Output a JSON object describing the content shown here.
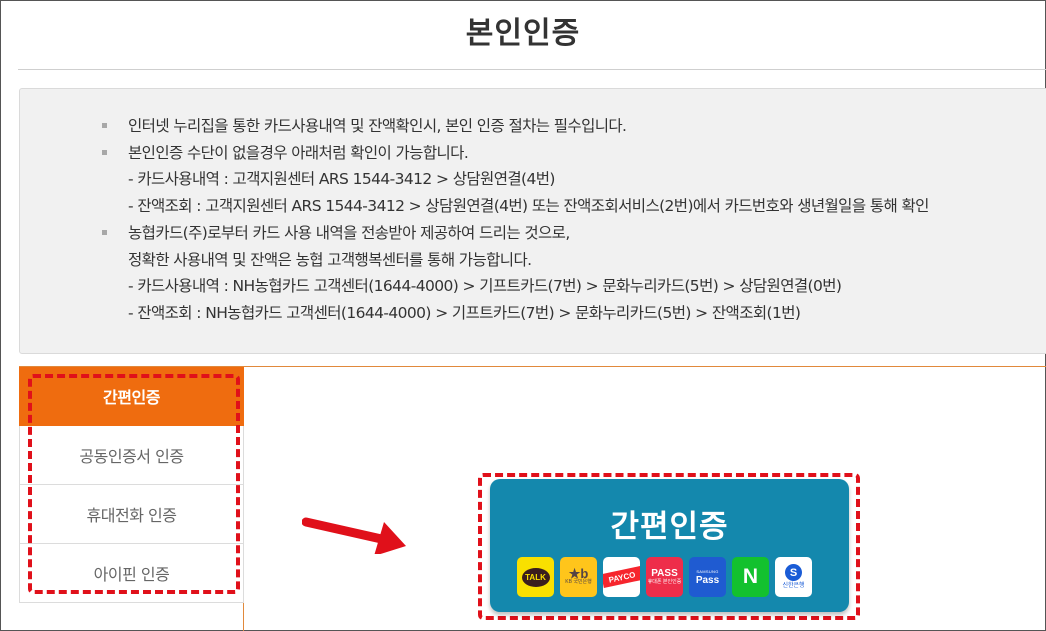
{
  "page": {
    "title": "본인인증"
  },
  "notice": {
    "items": [
      {
        "lines": [
          "인터넷 누리집을 통한 카드사용내역 및 잔액확인시, 본인 인증 절차는 필수입니다."
        ]
      },
      {
        "lines": [
          "본인인증 수단이 없을경우 아래처럼 확인이 가능합니다.",
          "- 카드사용내역 : 고객지원센터 ARS 1544-3412 > 상담원연결(4번)",
          "- 잔액조회 : 고객지원센터 ARS 1544-3412 > 상담원연결(4번) 또는 잔액조회서비스(2번)에서 카드번호와 생년월일을 통해 확인"
        ]
      },
      {
        "lines": [
          "농협카드(주)로부터 카드 사용 내역을 전송받아 제공하여 드리는 것으로,",
          "정확한 사용내역 및 잔액은 농협 고객행복센터를 통해 가능합니다.",
          "- 카드사용내역 : NH농협카드 고객센터(1644-4000) > 기프트카드(7번) > 문화누리카드(5번) > 상담원연결(0번)",
          "- 잔액조회 : NH농협카드 고객센터(1644-4000) > 기프트카드(7번) > 문화누리카드(5번) > 잔액조회(1번)"
        ]
      }
    ]
  },
  "auth_tabs": [
    {
      "label": "간편인증",
      "active": true
    },
    {
      "label": "공동인증서 인증",
      "active": false
    },
    {
      "label": "휴대전화 인증",
      "active": false
    },
    {
      "label": "아이핀 인증",
      "active": false
    }
  ],
  "simple_auth_card": {
    "title": "간편인증",
    "providers": {
      "kakao": {
        "icon": "kakao-talk-icon",
        "text": "TALK"
      },
      "kb": {
        "icon": "kb-bank-icon",
        "text": "★b",
        "sub": "KB 국민은행"
      },
      "payco": {
        "icon": "payco-icon",
        "text": "PAYCO"
      },
      "pass": {
        "icon": "pass-icon",
        "text": "PASS",
        "sub": "휴대폰 본인인증"
      },
      "samsung": {
        "icon": "samsung-pass-icon",
        "brand": "SAMSUNG",
        "text": "Pass"
      },
      "naver": {
        "icon": "naver-icon",
        "text": "N"
      },
      "shinhan": {
        "icon": "shinhan-bank-icon",
        "text": "S",
        "sub": "신한은행"
      }
    }
  },
  "colors": {
    "active_tab": "#ef6c0f",
    "card_background": "#1488ad",
    "highlight_dash": "#e0101a",
    "notice_background": "#f1f1f1"
  }
}
